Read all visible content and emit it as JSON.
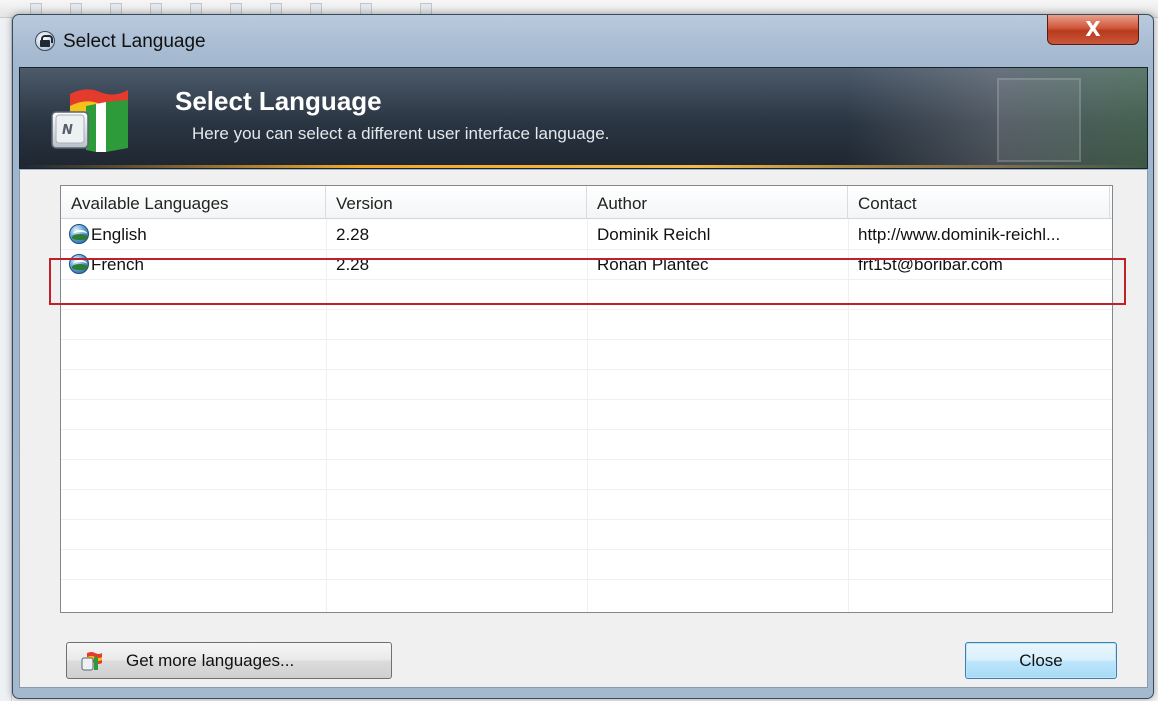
{
  "window": {
    "title": "Select Language",
    "close_glyph": "X"
  },
  "banner": {
    "title": "Select Language",
    "subtitle": "Here you can select a different user interface language."
  },
  "list": {
    "columns": [
      "Available Languages",
      "Version",
      "Author",
      "Contact"
    ],
    "rows": [
      {
        "language": "English",
        "version": "2.28",
        "author": "Dominik Reichl",
        "contact": "http://www.dominik-reichl..."
      },
      {
        "language": "French",
        "version": "2.28",
        "author": "Ronan Plantec",
        "contact": "frt15t@boribar.com"
      }
    ],
    "row_icon": "globe-icon"
  },
  "buttons": {
    "get_more": "Get more languages...",
    "close": "Close"
  },
  "colors": {
    "highlight": "#c0202a",
    "banner_accent": "#f0a830"
  }
}
